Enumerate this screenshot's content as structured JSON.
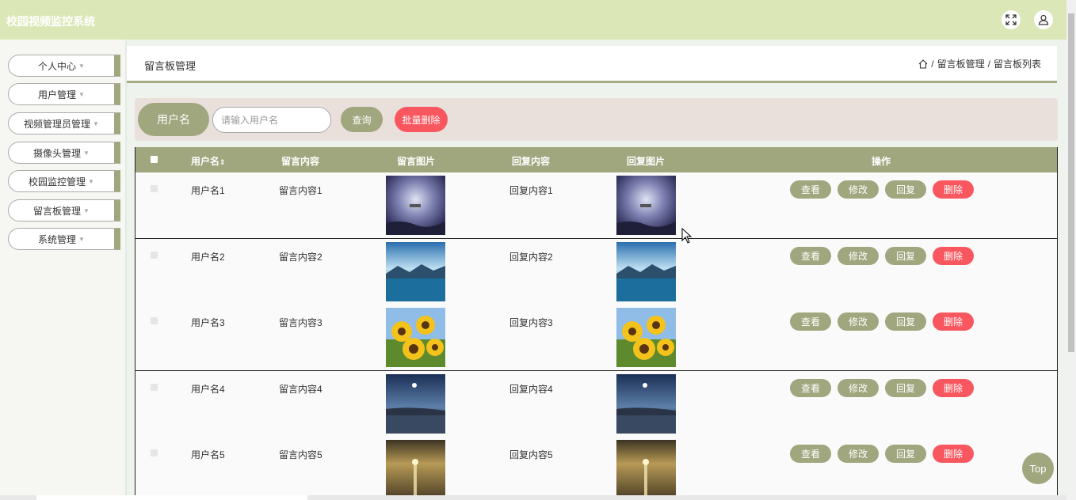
{
  "header": {
    "title": "校园视频监控系统",
    "fullscreen_icon": "expand-icon",
    "user_icon": "user-icon"
  },
  "sidebar": {
    "items": [
      {
        "label": "个人中心"
      },
      {
        "label": "用户管理"
      },
      {
        "label": "视频管理员管理"
      },
      {
        "label": "摄像头管理"
      },
      {
        "label": "校园监控管理"
      },
      {
        "label": "留言板管理"
      },
      {
        "label": "系统管理"
      }
    ]
  },
  "page": {
    "title": "留言板管理",
    "breadcrumb": [
      "留言板管理",
      "留言板列表"
    ],
    "separator": "/"
  },
  "search": {
    "label": "用户名",
    "placeholder": "请输入用户名",
    "query_button": "查询",
    "batch_delete_button": "批量删除"
  },
  "table": {
    "headers": {
      "username": "用户名",
      "content": "留言内容",
      "image": "留言图片",
      "reply": "回复内容",
      "reply_image": "回复图片",
      "actions": "操作"
    },
    "sort_icon": "sort-icon",
    "rows": [
      {
        "username": "用户名1",
        "content": "留言内容1",
        "reply": "回复内容1",
        "image": "night-sky-silhouette"
      },
      {
        "username": "用户名2",
        "content": "留言内容2",
        "reply": "回复内容2",
        "image": "blue-lake-mountains"
      },
      {
        "username": "用户名3",
        "content": "留言内容3",
        "reply": "回复内容3",
        "image": "sunflowers"
      },
      {
        "username": "用户名4",
        "content": "留言内容4",
        "reply": "回复内容4",
        "image": "night-city-bay"
      },
      {
        "username": "用户名5",
        "content": "留言内容5",
        "reply": "回复内容5",
        "image": "sunset-beach"
      }
    ],
    "actions": {
      "view": "查看",
      "edit": "修改",
      "reply": "回复",
      "delete": "删除"
    }
  },
  "top_button": "Top",
  "colors": {
    "header_bg": "#dce7b8",
    "accent": "#a0a77e",
    "danger": "#f9575f",
    "search_bg": "#e9e0dc"
  }
}
